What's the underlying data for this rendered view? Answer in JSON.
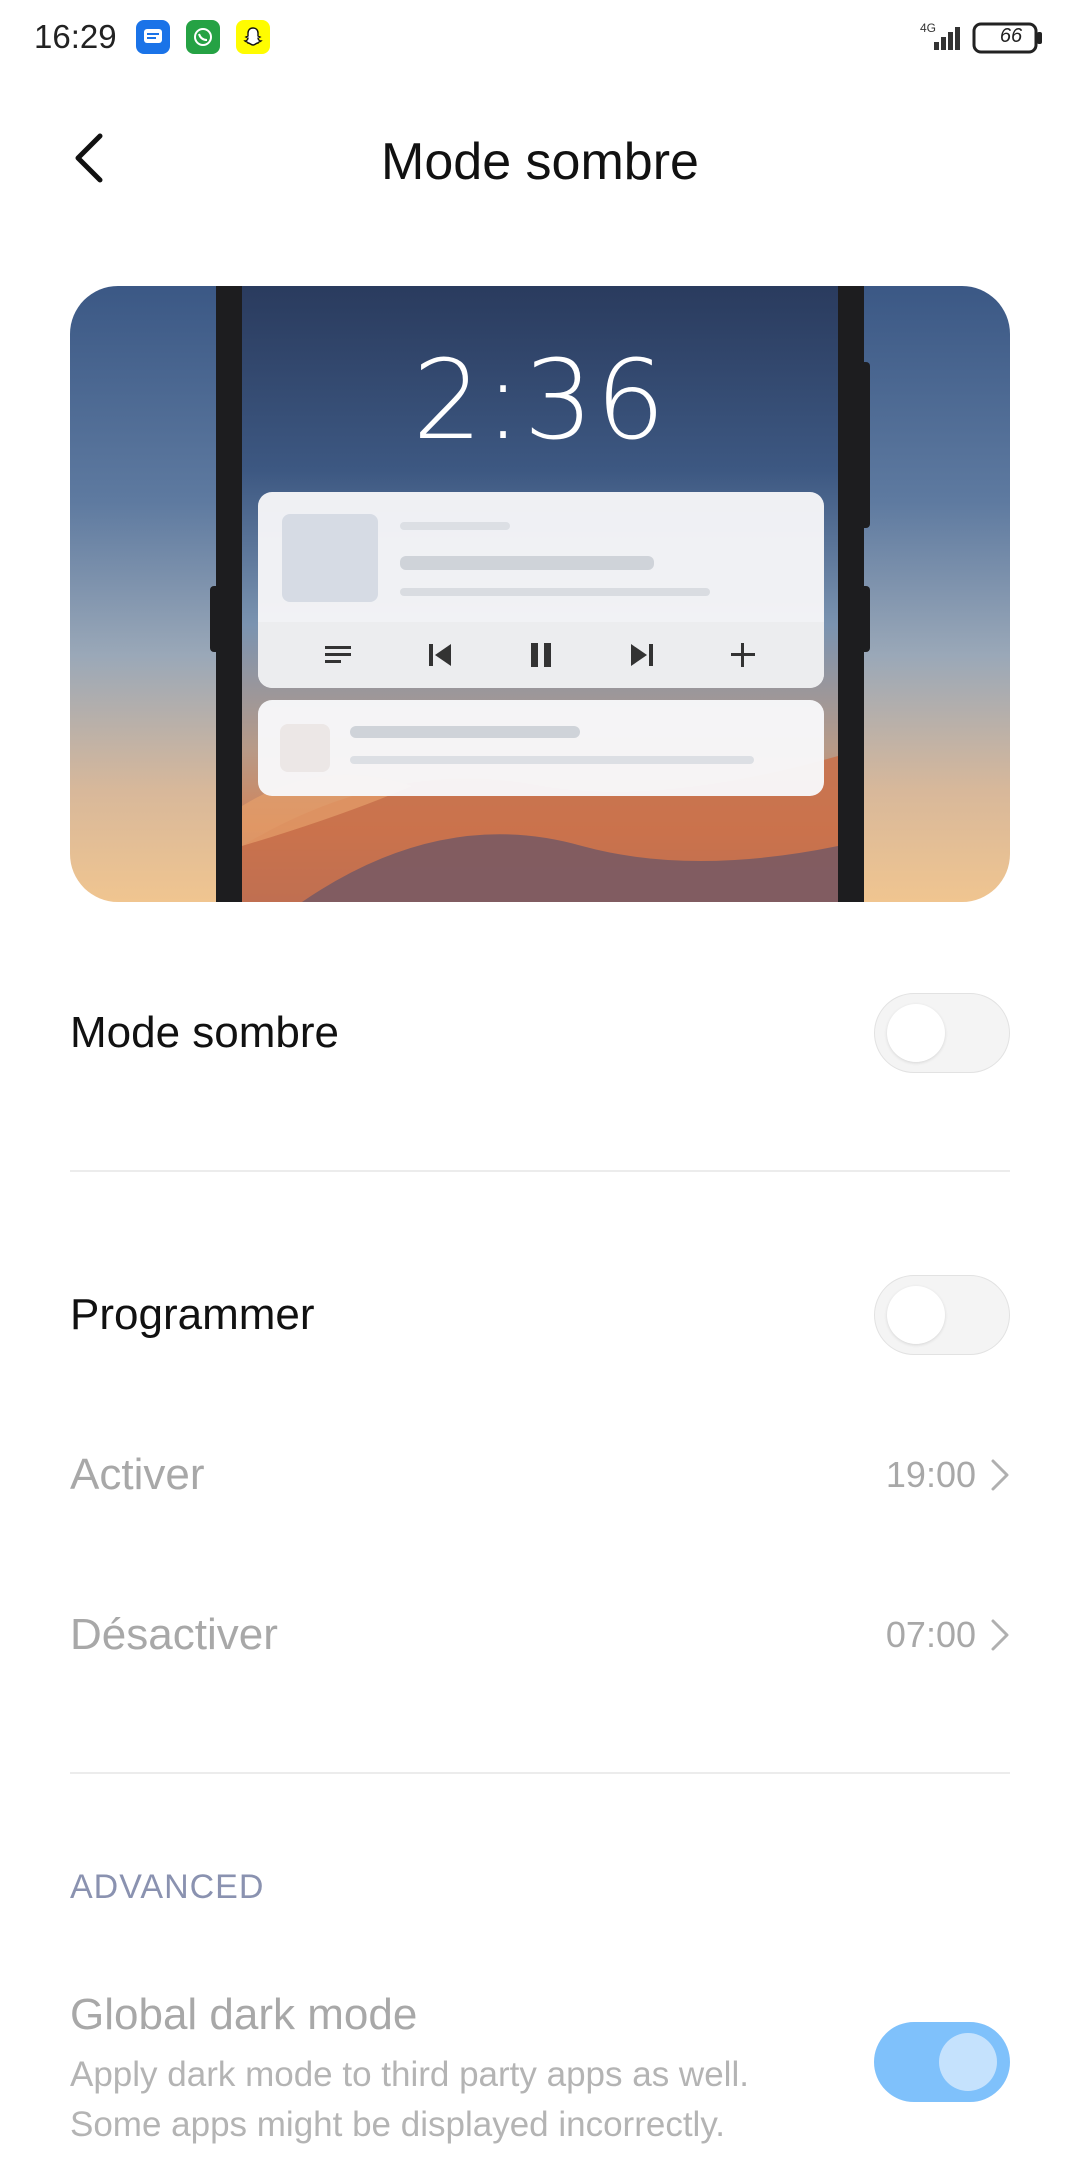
{
  "status_bar": {
    "time": "16:29",
    "network": "4G",
    "battery": "66",
    "app_icons": [
      "messages-icon",
      "whatsapp-icon",
      "snapchat-icon"
    ]
  },
  "header": {
    "title": "Mode sombre",
    "back_icon": "back-arrow-icon"
  },
  "preview": {
    "lock_time": "2:36",
    "media_controls": [
      "playlist-icon",
      "previous-icon",
      "pause-icon",
      "next-icon",
      "add-icon"
    ]
  },
  "settings": {
    "dark_mode": {
      "label": "Mode sombre",
      "enabled": false
    },
    "schedule": {
      "label": "Programmer",
      "enabled": false
    },
    "turn_on": {
      "label": "Activer",
      "value": "19:00"
    },
    "turn_off": {
      "label": "Désactiver",
      "value": "07:00"
    }
  },
  "advanced": {
    "header": "ADVANCED",
    "global_dark_mode": {
      "title": "Global dark mode",
      "description_line1": "Apply dark mode to third party apps as well.",
      "description_line2": "Some apps might be displayed incorrectly.",
      "enabled": true
    }
  },
  "colors": {
    "toggle_on": "#7fc1fb",
    "section_header": "#8a92b0",
    "disabled_text": "#a8a8a8"
  }
}
